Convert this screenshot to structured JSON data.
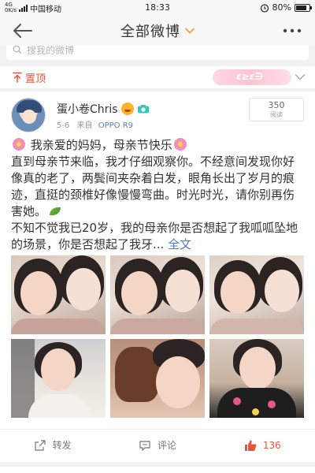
{
  "status_bar": {
    "network": "4G",
    "speed": "0K/s",
    "carrier": "中国移动",
    "time": "18:33",
    "battery_percent": "80%",
    "battery_level": 0.8
  },
  "nav": {
    "title": "全部微博"
  },
  "search": {
    "placeholder": "搜我的微博"
  },
  "pinned": {
    "label": "置顶",
    "decor_text": "ε≥ε∋"
  },
  "post": {
    "user_name": "蛋小卷Chris",
    "date": "5-6",
    "source_prefix": "来自",
    "source": "OPPO R9",
    "read_count": "350",
    "read_label": "阅读",
    "line1": "我亲爱的妈妈，母亲节快乐",
    "para1": "直到母亲节来临，我才仔细观察你。不经意间发现你好像真的老了，两鬓间夹杂着白发，眼角长出了岁月的痕迹，直挺的颈椎好像慢慢弯曲。时光时光，请你别再伤害她。",
    "para2": "不知不觉我已20岁，我的母亲你是否想起了我呱呱坠地的场景，你是否想起了我牙...",
    "full_text_link": "全文"
  },
  "actions": {
    "repost": "转发",
    "comment": "评论",
    "like_count": "136"
  },
  "colors": {
    "accent": "#e8533a",
    "link": "#4f7cc9",
    "nav_chevron": "#f1a33b"
  },
  "icons": [
    "back-arrow-icon",
    "chevron-down-icon",
    "more-icon",
    "search-icon",
    "pin-icon",
    "camera-icon",
    "flower-emoji-icon",
    "leaf-emoji-icon",
    "repost-icon",
    "comment-icon",
    "like-icon"
  ]
}
